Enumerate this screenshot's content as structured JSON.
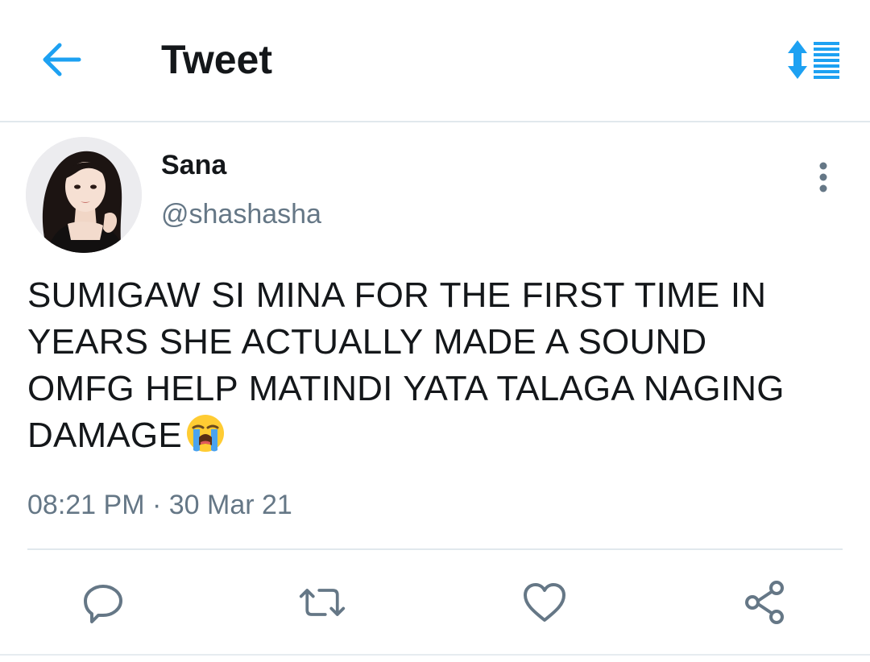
{
  "header": {
    "title": "Tweet",
    "back_icon": "arrow-left-icon",
    "sort_icon": "sort-order-icon",
    "accent_color": "#1da1f2"
  },
  "tweet": {
    "author": {
      "display_name": "Sana",
      "handle": "@shashasha",
      "avatar_icon": "user-avatar"
    },
    "text_lines": [
      "SUMIGAW SI MINA FOR THE FIRST TIME IN",
      "YEARS SHE ACTUALLY MADE A SOUND",
      "OMFG HELP MATINDI YATA TALAGA NAGING",
      "DAMAGE"
    ],
    "emoji": "😭",
    "timestamp": "08:21 PM · 30 Mar 21",
    "more_icon": "more-vertical-icon"
  },
  "actions": {
    "reply_icon": "reply-icon",
    "retweet_icon": "retweet-icon",
    "like_icon": "heart-icon",
    "share_icon": "share-icon",
    "icon_color": "#657786"
  }
}
